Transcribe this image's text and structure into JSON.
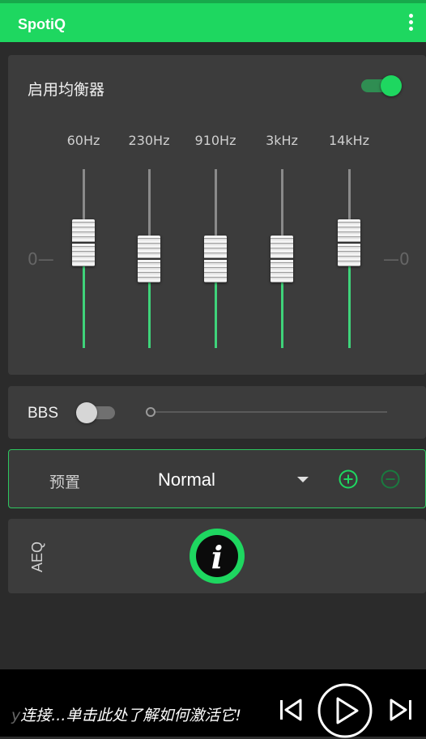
{
  "app": {
    "title": "SpotiQ"
  },
  "equalizer": {
    "enable_label": "启用均衡器",
    "enabled": true,
    "zero_left": "0",
    "zero_right": "0",
    "bands": [
      {
        "label": "60Hz",
        "level": 0.0
      },
      {
        "label": "230Hz",
        "level": 0.0
      },
      {
        "label": "910Hz",
        "level": 0.0
      },
      {
        "label": "3kHz",
        "level": 0.0
      },
      {
        "label": "14kHz",
        "level": 0.0
      }
    ]
  },
  "bbs": {
    "label": "BBS",
    "enabled": false,
    "level": 0.0
  },
  "preset": {
    "label": "预置",
    "value": "Normal"
  },
  "aeq": {
    "label": "AEQ",
    "info_glyph": "i"
  },
  "player": {
    "message_prefix": "y",
    "message": "连接...单击此处了解如何激活它!"
  },
  "colors": {
    "accent": "#1ed760",
    "background": "#2b2b2b",
    "card": "#3c3c3c"
  },
  "icons": [
    "more-vert-icon",
    "add-circle-icon",
    "remove-circle-icon",
    "info-icon",
    "skip-previous-icon",
    "play-icon",
    "skip-next-icon"
  ]
}
